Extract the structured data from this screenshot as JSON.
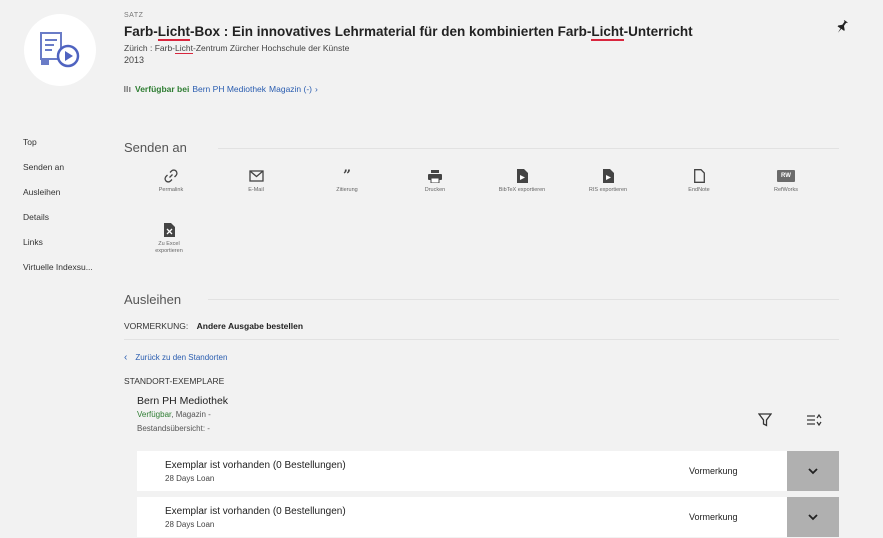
{
  "record": {
    "type": "SATZ",
    "title_parts": [
      "Farb-",
      "Licht",
      "-Box : Ein innovatives Lehrmaterial für den kombinierten Farb-",
      "Licht",
      "-Unterricht"
    ],
    "publisher_parts": [
      "Zürich : Farb-",
      "Licht",
      "-Zentrum Zürcher Hochschule der Künste"
    ],
    "year": "2013",
    "availability": {
      "status": "Verfügbar bei",
      "location": "Bern PH Mediothek",
      "sublocation": "Magazin (-)",
      "arrow": "›"
    }
  },
  "side_nav": [
    "Top",
    "Senden an",
    "Ausleihen",
    "Details",
    "Links",
    "Virtuelle Indexsu..."
  ],
  "send_section": {
    "heading": "Senden an",
    "actions": [
      {
        "label": "Permalink",
        "icon": "link-icon"
      },
      {
        "label": "E-Mail",
        "icon": "mail-icon"
      },
      {
        "label": "Zitierung",
        "icon": "quote-icon"
      },
      {
        "label": "Drucken",
        "icon": "print-icon"
      },
      {
        "label": "BibTeX exportieren",
        "icon": "bibtex-icon"
      },
      {
        "label": "RIS exportieren",
        "icon": "ris-icon"
      },
      {
        "label": "EndNote",
        "icon": "endnote-icon"
      },
      {
        "label": "RefWorks",
        "icon": "refworks-icon",
        "badge": "RW"
      },
      {
        "label": "Zu Excel exportieren",
        "icon": "excel-icon"
      }
    ]
  },
  "loan_section": {
    "heading": "Ausleihen",
    "vormerkung_label": "VORMERKUNG:",
    "vormerkung_action": "Andere Ausgabe bestellen",
    "back_link": "Zurück zu den Standorten",
    "standort_heading": "STANDORT-EXEMPLARE",
    "library": "Bern PH Mediothek",
    "status_available": "Verfügbar",
    "status_rest": ", Magazin -",
    "overview": "Bestandsübersicht: -",
    "items": [
      {
        "title": "Exemplar ist vorhanden (0 Bestellungen)",
        "policy": "28 Days Loan",
        "action": "Vormerkung"
      },
      {
        "title": "Exemplar ist vorhanden (0 Bestellungen)",
        "policy": "28 Days Loan",
        "action": "Vormerkung"
      }
    ]
  },
  "colors": {
    "available": "#2e7d32",
    "link": "#2a5db0",
    "highlight": "#d9263e",
    "expand_bg": "#b0b0b0"
  }
}
